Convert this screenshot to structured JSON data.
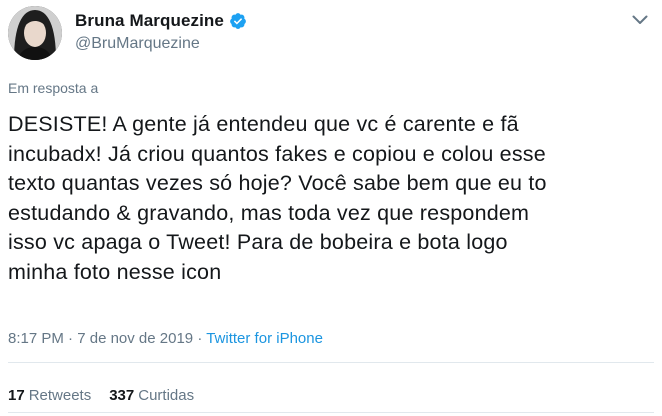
{
  "author": {
    "display_name": "Bruna Marquezine",
    "handle": "@BruMarquezine",
    "verified": true,
    "avatar_icon": "profile-photo"
  },
  "reply_context": "Em resposta a",
  "tweet": {
    "lines": [
      "DESISTE! A gente já entendeu que vc é carente e fã",
      "incubadx! Já criou quantos fakes e copiou e colou esse",
      "texto quantas vezes só hoje? Você sabe bem que eu to",
      "estudando & gravando, mas toda vez que respondem",
      "isso vc apaga o Tweet! Para de bobeira e bota logo",
      "minha foto nesse icon"
    ]
  },
  "meta": {
    "time": "8:17 PM",
    "separator": " · ",
    "date": "7 de nov de 2019",
    "source": "Twitter for iPhone"
  },
  "stats": {
    "retweets_count": "17",
    "retweets_label": "Retweets",
    "likes_count": "337",
    "likes_label": "Curtidas"
  },
  "colors": {
    "accent": "#1b95e0",
    "text": "#14171a",
    "secondary": "#657786",
    "divider": "#e1e8ed"
  },
  "icons": {
    "verified": "verified-badge-icon",
    "menu": "chevron-down-icon"
  }
}
